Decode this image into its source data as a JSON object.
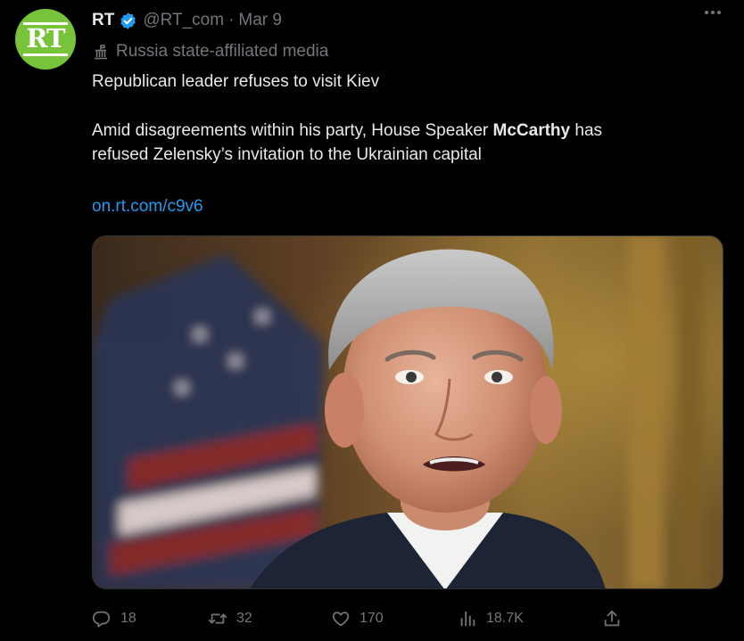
{
  "tweet": {
    "avatar_text": "RT",
    "display_name": "RT",
    "handle": "@RT_com",
    "separator": "·",
    "date": "Mar 9",
    "affiliation": "Russia state-affiliated media",
    "headline": "Republican leader refuses to visit Kiev",
    "body_line1_prefix": "Amid disagreements within his party, House Speaker ",
    "body_line1_bold": "McCarthy",
    "body_line1_suffix": " has",
    "body_line2": "refused Zelensky’s invitation to the Ukrainian capital",
    "link": "on.rt.com/c9v6"
  },
  "actions": {
    "replies": "18",
    "retweets": "32",
    "likes": "170",
    "views": "18.7K"
  },
  "colors": {
    "background": "#000000",
    "text": "#e7e9ea",
    "muted": "#71767b",
    "link": "#1d9bf0",
    "avatar": "#77c33a",
    "verified": "#1d9bf0"
  },
  "icons": {
    "verified": "verified-badge-icon",
    "affiliation": "government-building-icon",
    "more": "more-dots-icon",
    "reply": "reply-icon",
    "retweet": "retweet-icon",
    "like": "heart-icon",
    "views": "views-chart-icon",
    "share": "share-icon"
  }
}
